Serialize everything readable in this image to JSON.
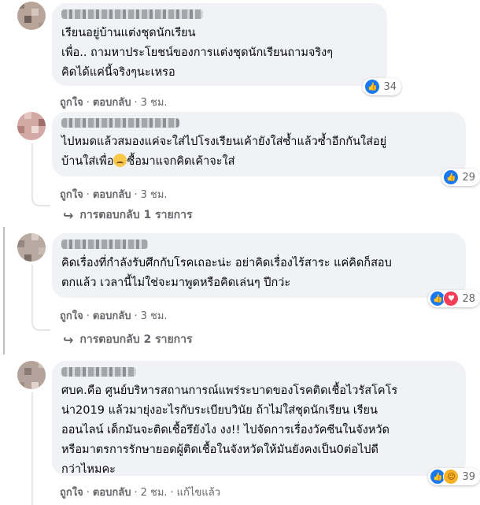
{
  "comments": [
    {
      "text": "เรียนอยู่บ้านแต่งชุดนักเรียน\nเพื่อ.. ถามหาประโยชน์ของการแต่งชุดนักเรียนถามจริงๆ\nคิดได้แค่นี้จริงๆนะเหรอ",
      "reaction_count": "34",
      "like_label": "ถูกใจ",
      "reply_label": "ตอบกลับ",
      "time": "3 ชม."
    },
    {
      "text_a": "ไปหมดแล้วสมองแค่จะใส่ไปโรงเรียนเค้ายังใส่ซ้ำแล้วซ้ำอีกกันใส่อยู่\nบ้านใส่เพื่อ",
      "text_b": "ซื้อมาแจกคิดเค้าจะใส่",
      "reaction_count": "29",
      "like_label": "ถูกใจ",
      "reply_label": "ตอบกลับ",
      "time": "3 ชม.",
      "replies_label": "การตอบกลับ 1 รายการ"
    },
    {
      "text": "คิดเรื่องที่กำลังรับศึกกับโรคเถอะน่ะ อย่าคิดเรื่องไร้สาระ แค่คิดก็สอบ\nตกแล้ว เวลานี้ไม่ใช่จะมาพูดหรือคิดเล่นๆ ปีกว่ะ",
      "reaction_count": "28",
      "like_label": "ถูกใจ",
      "reply_label": "ตอบกลับ",
      "time": "3 ชม.",
      "replies_label": "การตอบกลับ 2 รายการ"
    },
    {
      "text": "ศบค.คือ ศูนย์บริหารสถานการณ์แพร่ระบาดของโรคติดเชื้อไวรัสโคโร\nน่า2019 แล้วมายุ่งอะไรกับระเบียบวินัย ถ้าไม่ใส่ชุดนักเรียน เรียน\nออนไลน์ เด็กมันจะติดเชื้อรึยังไง งง!! ไปจัดการเรื่องวัคซีนในจังหวัด\nหรือมาตรการรักษายอดผู้ติดเชื้อในจังหวัดให้มันยังคงเป็น0ต่อไปดี\nกว่าไหมคะ",
      "reaction_count": "39",
      "like_label": "ถูกใจ",
      "reply_label": "ตอบกลับ",
      "time": "2 ชม.",
      "edited_label": "แก้ไขแล้ว"
    }
  ],
  "colors": {
    "bubble": "#f0f2f5",
    "meta": "#65676b",
    "like": "#1877f2",
    "love": "#f33e58",
    "haha": "#f7b125"
  }
}
